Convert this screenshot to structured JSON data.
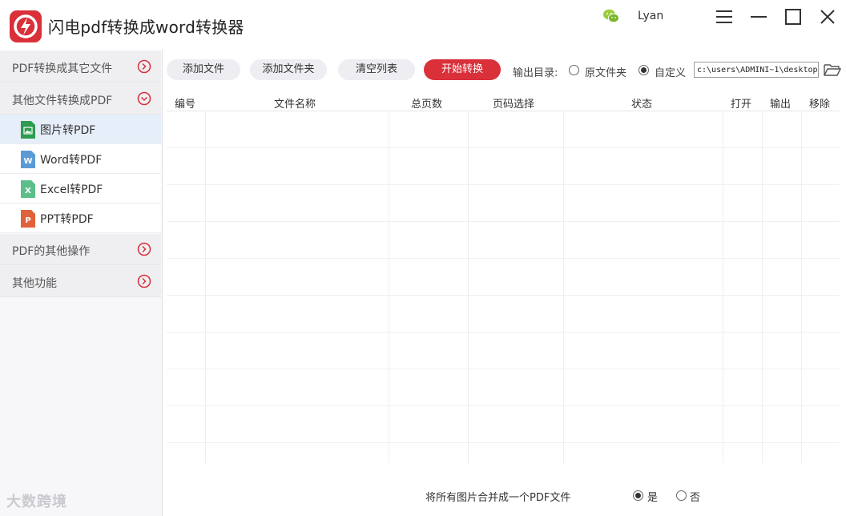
{
  "app": {
    "title": "闪电pdf转换成word转换器",
    "username": "Lyan",
    "accent_color": "#d9303a"
  },
  "sidebar": {
    "sections": [
      {
        "label": "PDF转换成其它文件",
        "icon": "chevron-right-circle-icon"
      },
      {
        "label": "其他文件转换成PDF",
        "icon": "chevron-down-circle-icon"
      },
      {
        "label": "PDF的其他操作",
        "icon": "chevron-right-circle-icon"
      },
      {
        "label": "其他功能",
        "icon": "chevron-right-circle-icon"
      }
    ],
    "items": [
      {
        "label": "图片转PDF",
        "icon": "image-file-icon",
        "active": true
      },
      {
        "label": "Word转PDF",
        "icon": "word-file-icon",
        "active": false
      },
      {
        "label": "Excel转PDF",
        "icon": "excel-file-icon",
        "active": false
      },
      {
        "label": "PPT转PDF",
        "icon": "ppt-file-icon",
        "active": false
      }
    ]
  },
  "toolbar": {
    "add_file": "添加文件",
    "add_folder": "添加文件夹",
    "clear_list": "清空列表",
    "start_convert": "开始转换",
    "output_label": "输出目录:",
    "output_original": "原文件夹",
    "output_custom": "自定义",
    "output_path": "c:\\users\\ADMINI~1\\desktop",
    "selected_output": "自定义"
  },
  "table": {
    "columns": [
      "编号",
      "文件名称",
      "总页数",
      "页码选择",
      "状态",
      "打开",
      "输出",
      "移除"
    ],
    "rows": []
  },
  "footer": {
    "merge_label": "将所有图片合并成一个PDF文件",
    "yes": "是",
    "no": "否",
    "selected": "是"
  },
  "watermark": {
    "text": "大数跨境"
  }
}
